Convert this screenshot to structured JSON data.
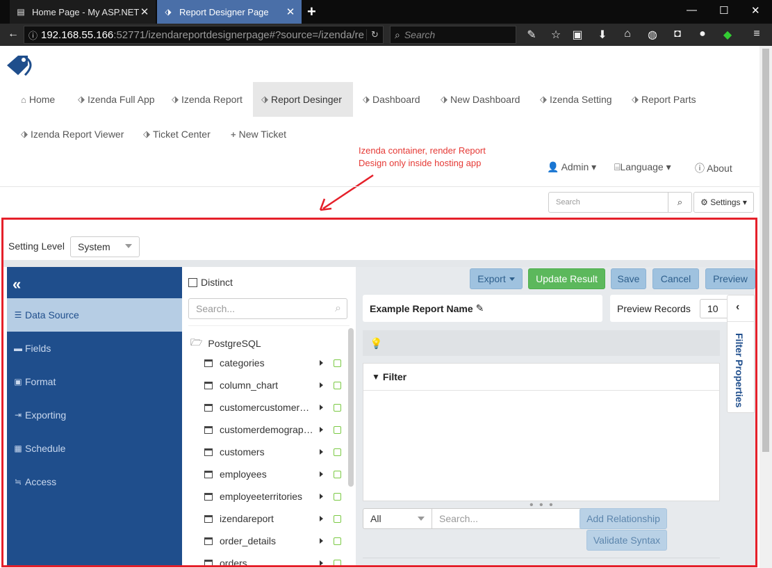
{
  "browser": {
    "tabs": [
      {
        "label": "Home Page - My ASP.NET..."
      },
      {
        "label": "Report Designer Page"
      }
    ],
    "url_host": "192.168.55.166",
    "url_rest": ":52771/izendareportdesignerpage#?source=/izenda/re",
    "search_placeholder": "Search"
  },
  "site": {
    "menu": [
      {
        "label": "Home",
        "icon": "home-icon"
      },
      {
        "label": "Izenda Full App",
        "icon": "tag-icon"
      },
      {
        "label": "Izenda Report",
        "icon": "tag-icon"
      },
      {
        "label": "Report Desinger",
        "icon": "tag-icon"
      },
      {
        "label": "Dashboard",
        "icon": "tag-icon"
      },
      {
        "label": "New Dashboard",
        "icon": "tag-icon"
      },
      {
        "label": "Izenda Setting",
        "icon": "tag-icon"
      },
      {
        "label": "Report Parts",
        "icon": "tag-icon"
      },
      {
        "label": "Izenda Report Viewer",
        "icon": "tag-icon"
      },
      {
        "label": "Ticket Center",
        "icon": "tag-icon"
      },
      {
        "label": "New Ticket",
        "icon": "plus-icon"
      }
    ],
    "note_line1": "Izenda container, render Report",
    "note_line2": "Design only inside hosting app",
    "user_menu": {
      "admin": "Admin",
      "language": "Language",
      "about": "About"
    },
    "search_placeholder": "Search",
    "settings_label": "Settings"
  },
  "designer": {
    "setting_level_label": "Setting Level",
    "setting_level_value": "System",
    "left_nav": [
      {
        "label": "Data Source",
        "icon": "list-icon"
      },
      {
        "label": "Fields",
        "icon": "minus-icon"
      },
      {
        "label": "Format",
        "icon": "format-icon"
      },
      {
        "label": "Exporting",
        "icon": "export-icon"
      },
      {
        "label": "Schedule",
        "icon": "calendar-icon"
      },
      {
        "label": "Access",
        "icon": "access-icon"
      }
    ],
    "distinct_label": "Distinct",
    "tree_search_placeholder": "Search...",
    "tree_root": "PostgreSQL",
    "tables": [
      "categories",
      "column_chart",
      "customercustomerdemo",
      "customerdemographics",
      "customers",
      "employees",
      "employeeterritories",
      "izendareport",
      "order_details",
      "orders"
    ],
    "buttons": {
      "export": "Export",
      "update": "Update Result",
      "save": "Save",
      "cancel": "Cancel",
      "preview": "Preview",
      "add_relationship": "Add Relationship",
      "validate_syntax": "Validate Syntax"
    },
    "report_name": "Example Report Name",
    "preview_records_label": "Preview Records",
    "preview_records_value": "10",
    "filter_label": "Filter",
    "filter_all_value": "All",
    "field_search_placeholder": "Search...",
    "filter_properties_label": "Filter Properties"
  },
  "colors": {
    "nav_blue": "#1f4e8c",
    "active_nav": "#b6cde4",
    "green_button": "#5cb85c",
    "light_button": "#9fc2df",
    "annotation_red": "#e5202a"
  }
}
